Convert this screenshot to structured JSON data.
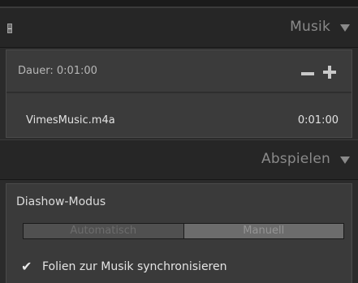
{
  "music_panel": {
    "title": "Musik",
    "duration_label": "Dauer: 0:01:00",
    "file_name": "VimesMusic.m4a",
    "file_duration": "0:01:00"
  },
  "playback_panel": {
    "title": "Abspielen",
    "mode_label": "Diashow-Modus",
    "mode_options": [
      "Automatisch",
      "Manuell"
    ],
    "selected_mode": "Manuell",
    "sync_label": "Folien zur Musik synchronisieren",
    "sync_checked": true
  }
}
